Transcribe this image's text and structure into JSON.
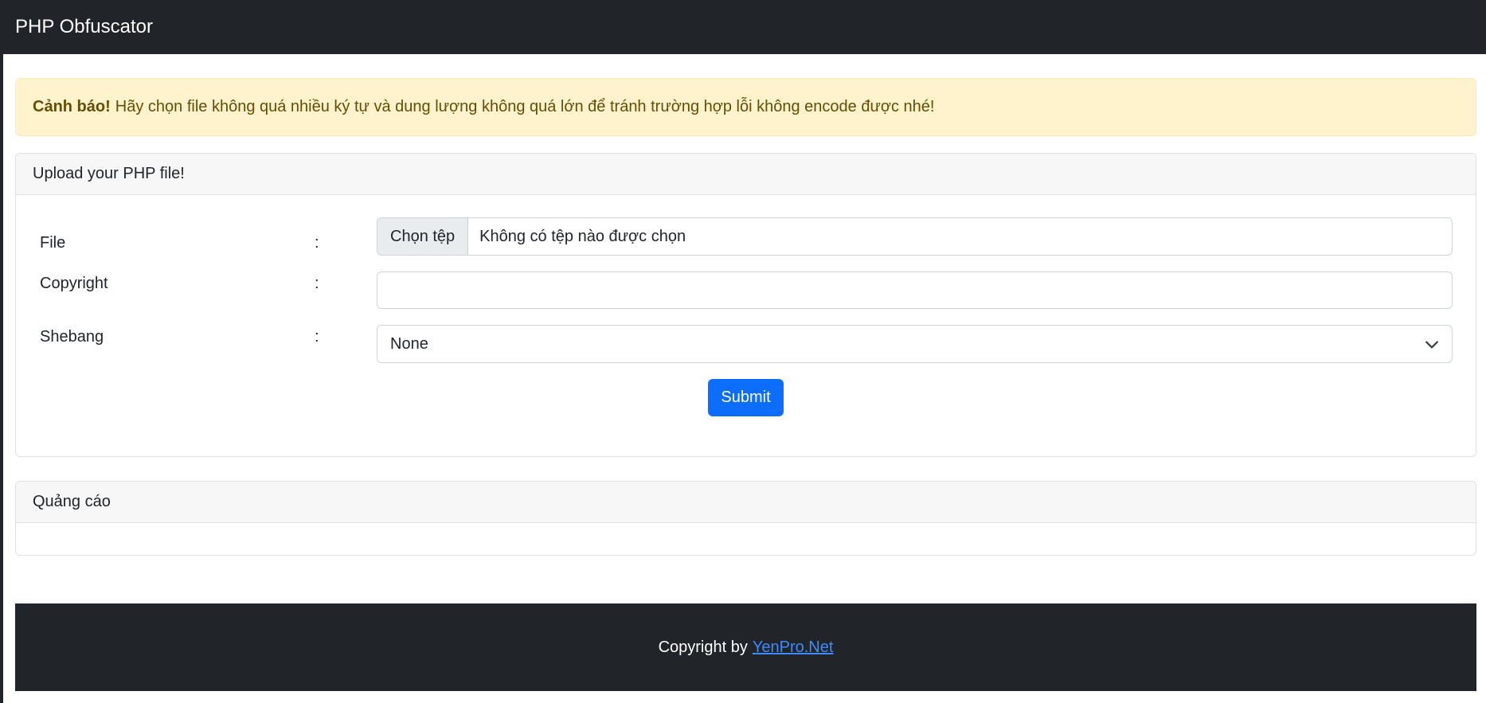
{
  "navbar": {
    "brand": "PHP Obfuscator"
  },
  "alert": {
    "strong": "Cảnh báo!",
    "message": "Hãy chọn file không quá nhiều ký tự và dung lượng không quá lớn để tránh trường hợp lỗi không encode được nhé!"
  },
  "upload_card": {
    "header": "Upload your PHP file!",
    "colon": ":",
    "file": {
      "label": "File",
      "button": "Chọn tệp",
      "status": "Không có tệp nào được chọn"
    },
    "copyright": {
      "label": "Copyright",
      "value": "",
      "placeholder": ""
    },
    "shebang": {
      "label": "Shebang",
      "selected": "None"
    },
    "submit_label": "Submit"
  },
  "ads_card": {
    "header": "Quảng cáo"
  },
  "footer": {
    "text": "Copyright by",
    "link_text": "YenPro.Net"
  },
  "colors": {
    "dark": "#212529",
    "primary": "#0d6efd",
    "warning_bg": "#fff3cd",
    "warning_text": "#664d03"
  }
}
